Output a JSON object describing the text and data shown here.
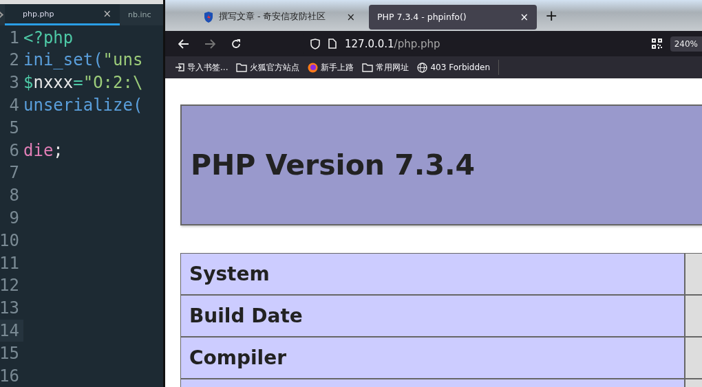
{
  "editor": {
    "tabs": [
      {
        "label": "php.php",
        "selected": true,
        "close": "×"
      },
      {
        "label": "nb.inc",
        "selected": false
      }
    ],
    "lines": [
      {
        "number": "1",
        "tokens": [
          {
            "text": "<?php",
            "kind": "tag"
          }
        ]
      },
      {
        "number": "2",
        "tokens": [
          {
            "text": "ini_set(",
            "kind": "func"
          },
          {
            "text": "\"uns",
            "kind": "string"
          }
        ]
      },
      {
        "number": "3",
        "tokens": [
          {
            "text": "$",
            "kind": "tag"
          },
          {
            "text": "nxxx",
            "kind": "plain"
          },
          {
            "text": "=",
            "kind": "tag"
          },
          {
            "text": "\"O:2:\\",
            "kind": "string"
          }
        ]
      },
      {
        "number": "4",
        "tokens": [
          {
            "text": "unserialize(",
            "kind": "func"
          }
        ]
      },
      {
        "number": "5"
      },
      {
        "number": "6",
        "tokens": [
          {
            "text": "die",
            "kind": "keyword"
          },
          {
            "text": ";",
            "kind": "plain"
          }
        ]
      },
      {
        "number": "7"
      },
      {
        "number": "8"
      },
      {
        "number": "9"
      },
      {
        "number": "10"
      },
      {
        "number": "11"
      },
      {
        "number": "12"
      },
      {
        "number": "13"
      },
      {
        "number": "14",
        "current": true
      },
      {
        "number": "15"
      },
      {
        "number": "16"
      }
    ]
  },
  "browser": {
    "tabs": [
      {
        "title": "撰写文章 - 奇安信攻防社区",
        "selected": false,
        "close": "×"
      },
      {
        "title": "PHP 7.3.4 - phpinfo()",
        "selected": true,
        "close": "×"
      }
    ],
    "new_tab": "+",
    "address": {
      "host": "127.0.0.1",
      "path": "/php.php"
    },
    "zoom": "240%",
    "bookmarks": [
      {
        "label": "导入书签...",
        "kind": "import"
      },
      {
        "label": "火狐官方站点",
        "kind": "folder"
      },
      {
        "label": "新手上路",
        "kind": "firefox"
      },
      {
        "label": "常用网址",
        "kind": "folder"
      },
      {
        "label": "403 Forbidden",
        "kind": "globe"
      }
    ],
    "page": {
      "heading": "PHP Version 7.3.4",
      "rows": [
        "System",
        "Build Date",
        "Compiler"
      ]
    }
  }
}
